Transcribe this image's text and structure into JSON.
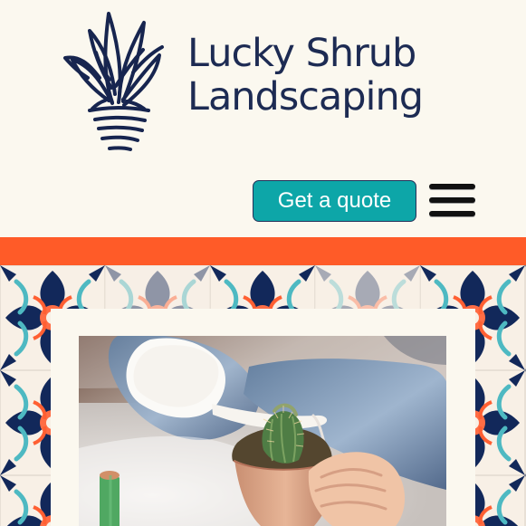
{
  "header": {
    "brand_line_1": "Lucky Shrub",
    "brand_line_2": "Landscaping",
    "quote_button": "Get a quote",
    "logo_icon": "shrub-in-pot-icon",
    "menu_icon": "hamburger-menu-icon"
  },
  "hero": {
    "image": "hand watering potted cactus"
  },
  "colors": {
    "background": "#fbf8ef",
    "brand_navy": "#1d2b53",
    "quote_teal": "#0da6a8",
    "accent_orange": "#ff5b28",
    "tile_navy": "#11295b",
    "tile_teal": "#4fb6c0"
  }
}
